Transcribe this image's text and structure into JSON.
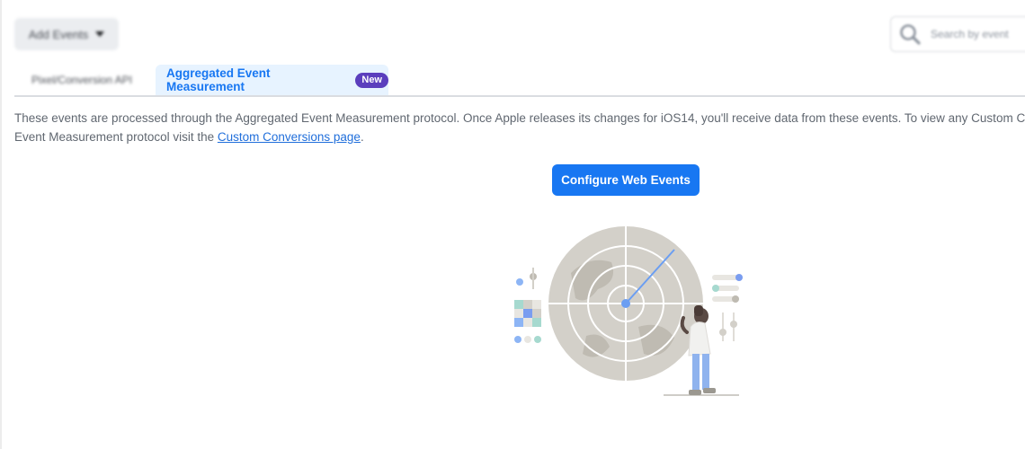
{
  "toolbar": {
    "add_events_label": "Add Events",
    "search_placeholder": "Search by event"
  },
  "tabs": [
    {
      "label": "Pixel/Conversion API",
      "active": false
    },
    {
      "label": "Aggregated Event Measurement",
      "active": true,
      "badge": "New"
    }
  ],
  "intro": {
    "line1": "These events are processed through the Aggregated Event Measurement protocol. Once Apple releases its changes for iOS14, you'll receive data from these events. To view any Custom Conv",
    "line2_prefix": "Event Measurement protocol visit the ",
    "link_text": "Custom Conversions page",
    "line2_suffix": "."
  },
  "main": {
    "configure_button_label": "Configure Web Events"
  },
  "illustration": {
    "name": "radar-illustration"
  },
  "colors": {
    "accent": "#1877f2",
    "badge": "#5b3ebd",
    "tab_active_bg": "#e7f3ff"
  }
}
